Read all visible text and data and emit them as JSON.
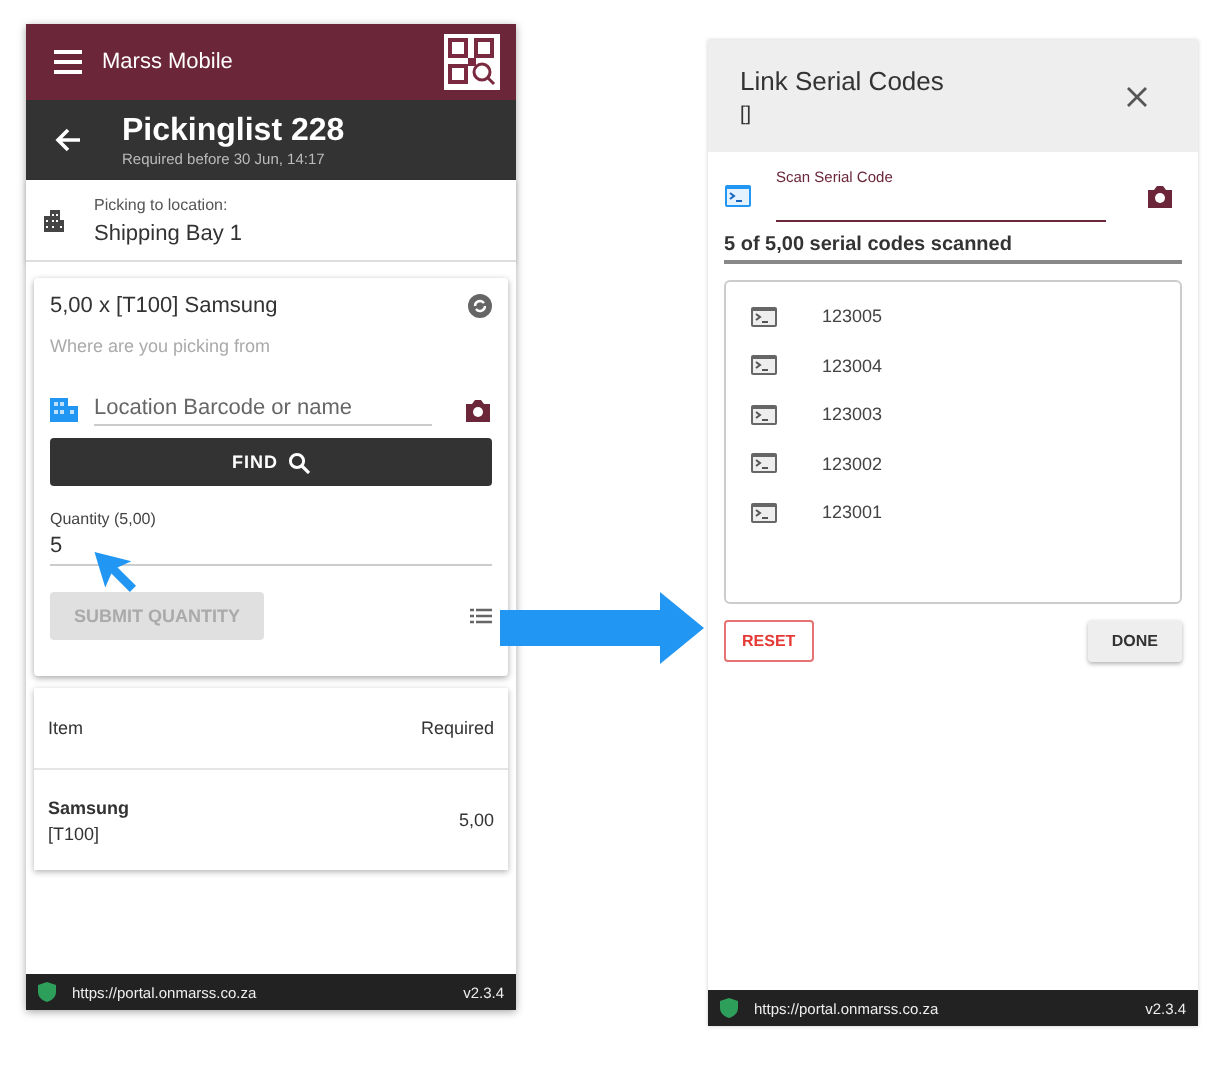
{
  "left_screen": {
    "app_bar": {
      "title": "Marss Mobile"
    },
    "header": {
      "title": "Pickinglist 228",
      "subtitle": "Required before 30 Jun, 14:17"
    },
    "location": {
      "label": "Picking to location:",
      "value": "Shipping Bay 1"
    },
    "pick_card": {
      "title": "5,00 x [T100] Samsung",
      "hint": "Where are you picking from",
      "location_field": {
        "placeholder": "Location Barcode or name"
      },
      "find_button": "FIND",
      "quantity_field": {
        "label": "Quantity (5,00)",
        "value": "5"
      },
      "submit_button": {
        "label": "SUBMIT QUANTITY",
        "disabled": true
      }
    },
    "table": {
      "columns": [
        "Item",
        "Required"
      ],
      "rows": [
        {
          "name": "Samsung",
          "code": "[T100]",
          "required": "5,00"
        }
      ]
    },
    "footer": {
      "url": "https://portal.onmarss.co.za",
      "version": "v2.3.4"
    }
  },
  "right_screen": {
    "dialog": {
      "title": "Link Serial Codes",
      "subtitle": "[]"
    },
    "scan_field": {
      "label": "Scan Serial Code"
    },
    "progress": "5 of 5,00 serial codes scanned",
    "serials": [
      "123005",
      "123004",
      "123003",
      "123002",
      "123001"
    ],
    "buttons": [
      {
        "kind": "outlined",
        "label": "RESET"
      },
      {
        "kind": "raised",
        "label": "DONE"
      }
    ],
    "footer": {
      "url": "https://portal.onmarss.co.za",
      "version": "v2.3.4"
    }
  }
}
